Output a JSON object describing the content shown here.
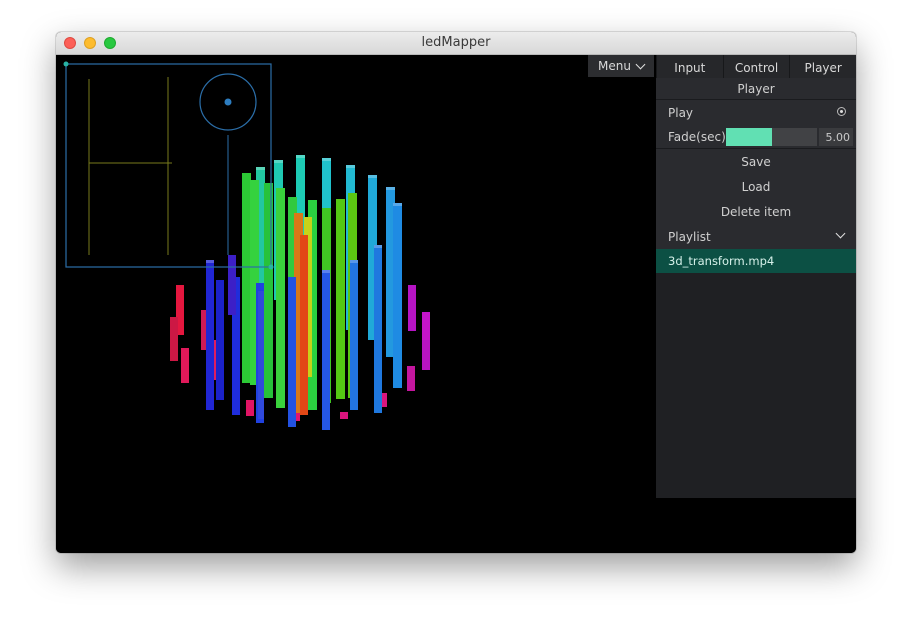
{
  "window": {
    "title": "ledMapper"
  },
  "menu": {
    "label": "Menu"
  },
  "tabs": [
    {
      "label": "Input"
    },
    {
      "label": "Control"
    },
    {
      "label": "Player"
    }
  ],
  "panel": {
    "header": "Player",
    "play": {
      "label": "Play"
    },
    "fade": {
      "label": "Fade(sec)",
      "value": "5.00",
      "fraction": 0.5
    },
    "save_label": "Save",
    "load_label": "Load",
    "delete_label": "Delete item",
    "playlist": {
      "label": "Playlist",
      "items": [
        {
          "name": "3d_transform.mp4"
        }
      ]
    }
  },
  "colors": {
    "accent": "#61e0b3",
    "selected_item": "#0c5044",
    "overlay": "#2b6ea8"
  },
  "icons": {
    "menu": "chevron-down-icon",
    "play": "radio-icon",
    "playlist": "chevron-down-icon"
  }
}
